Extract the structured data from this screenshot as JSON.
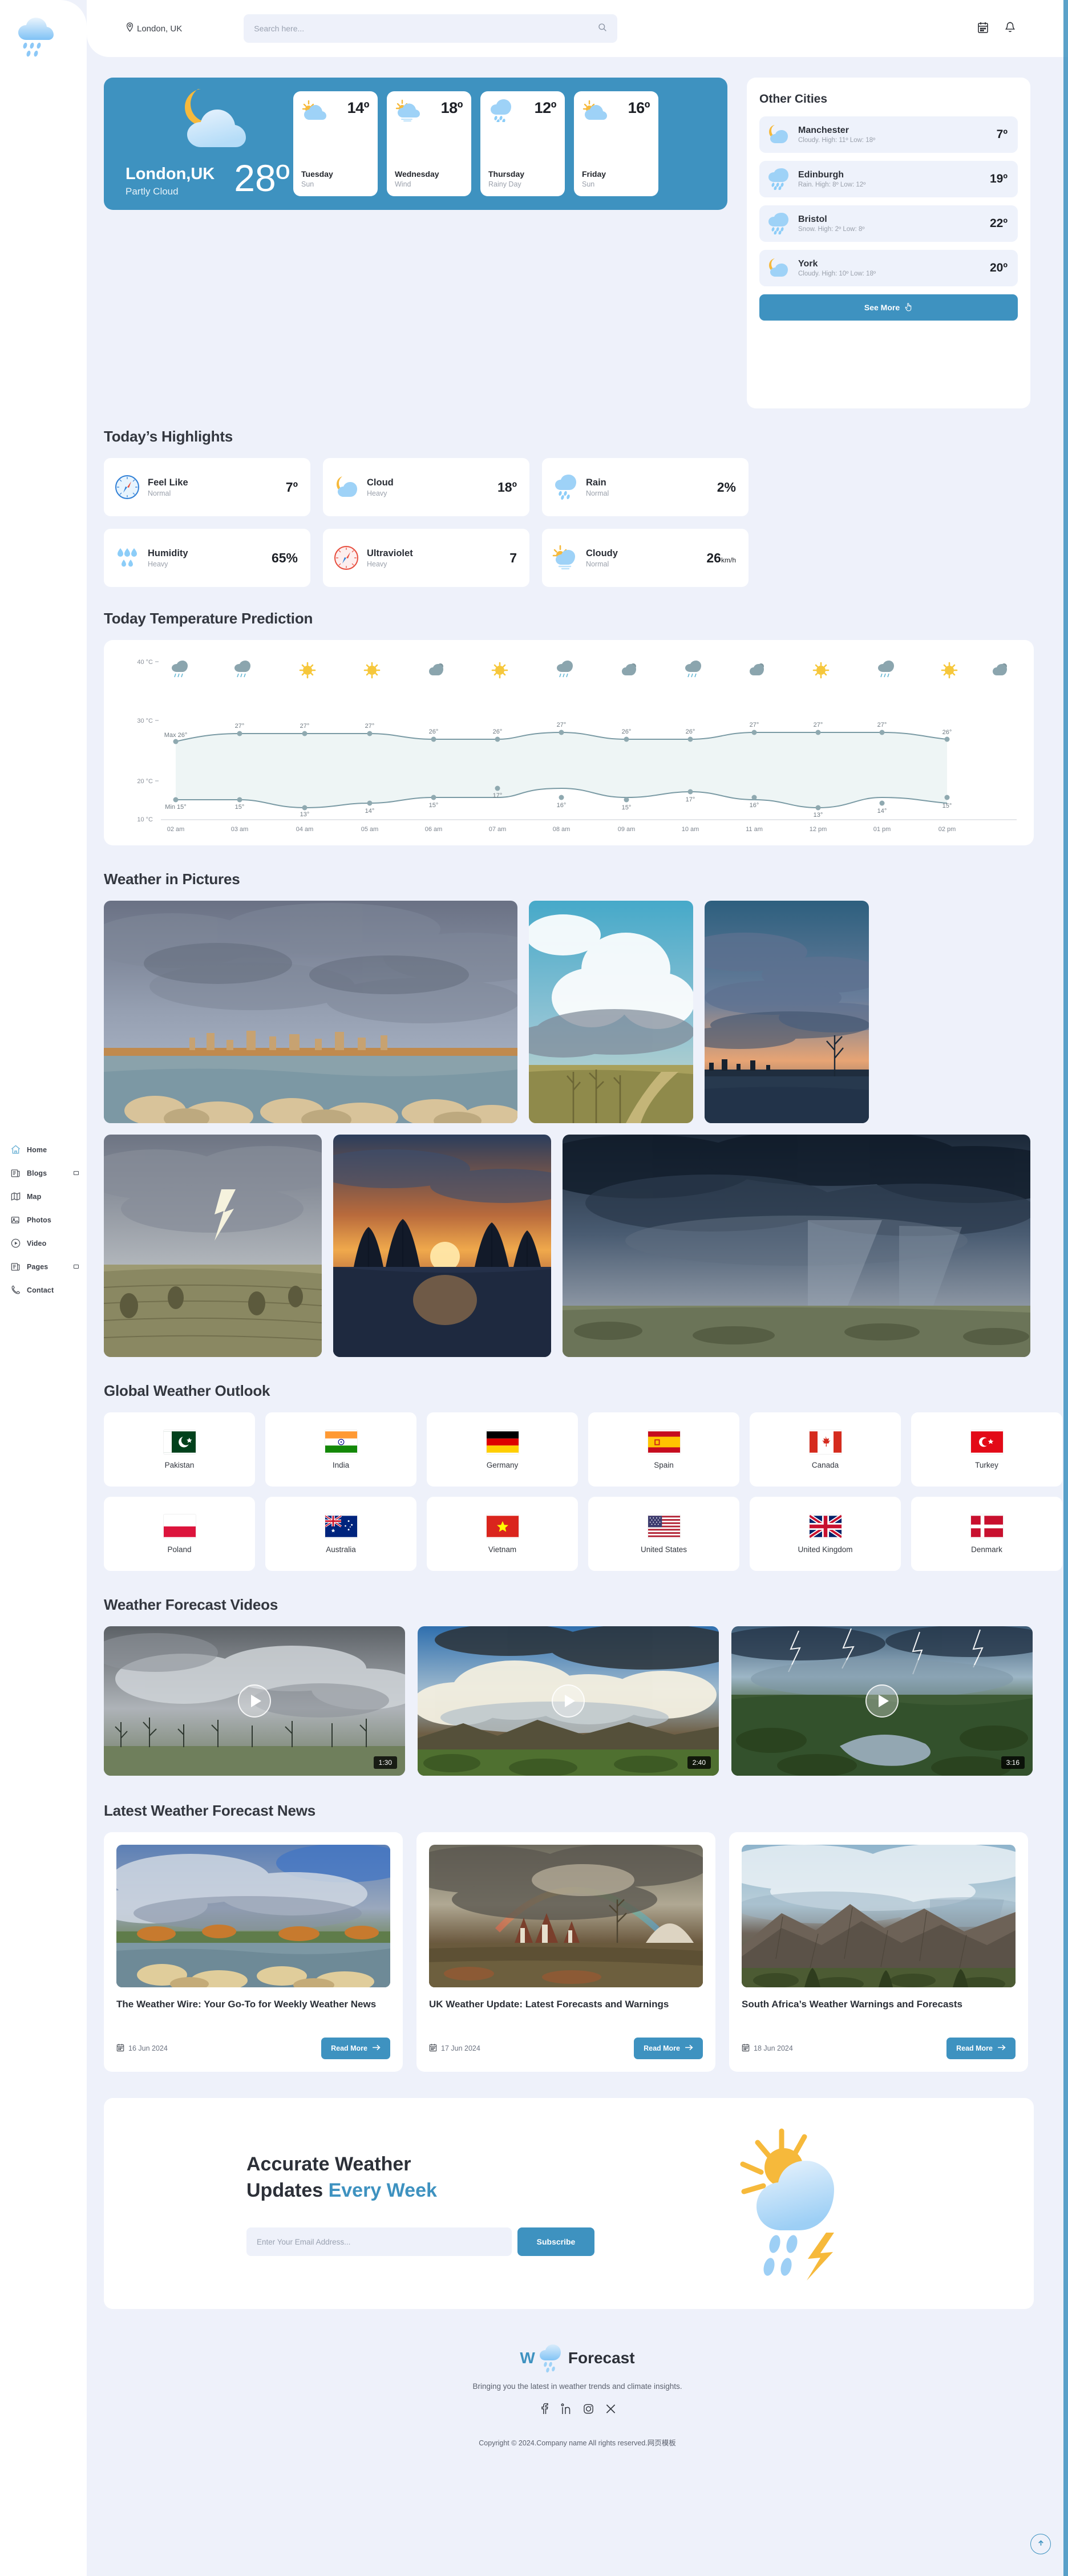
{
  "brand": {
    "logo_w": "W",
    "logo_text": "Forecast"
  },
  "topbar": {
    "location": "London, UK",
    "search_placeholder": "Search here...",
    "search_value": "",
    "icons": {
      "location": "location-pin-icon",
      "search": "search-icon",
      "calendar": "calendar-icon",
      "bell": "bell-icon"
    }
  },
  "sidebar": {
    "items": [
      {
        "label": "Home",
        "icon": "home-icon",
        "caret": false
      },
      {
        "label": "Blogs",
        "icon": "news-icon",
        "caret": true
      },
      {
        "label": "Map",
        "icon": "map-icon",
        "caret": false
      },
      {
        "label": "Photos",
        "icon": "photo-icon",
        "caret": false
      },
      {
        "label": "Video",
        "icon": "play-circle-icon",
        "caret": false
      },
      {
        "label": "Pages",
        "icon": "news-icon",
        "caret": true
      },
      {
        "label": "Contact",
        "icon": "phone-icon",
        "caret": false
      }
    ]
  },
  "hero": {
    "city": "London,UK",
    "condition": "Partly Cloud",
    "temperature": "28º",
    "icon": "moon-cloud-icon",
    "accent": "#3e92c0"
  },
  "forecast": [
    {
      "day": "Tuesday",
      "desc": "Sun",
      "temp": "14º",
      "icon": "sun-cloud-icon"
    },
    {
      "day": "Wednesday",
      "desc": "Wind",
      "temp": "18º",
      "icon": "sun-cloud-wind-icon"
    },
    {
      "day": "Thursday",
      "desc": "Rainy Day",
      "temp": "12º",
      "icon": "rain-cloud-icon"
    },
    {
      "day": "Friday",
      "desc": "Sun",
      "temp": "16º",
      "icon": "sun-cloud-icon"
    }
  ],
  "other_cities": {
    "title": "Other Cities",
    "see_more": "See More",
    "items": [
      {
        "name": "Manchester",
        "sub": "Cloudy. High: 11º Low: 18º",
        "temp": "7º",
        "icon": "moon-cloud-icon"
      },
      {
        "name": "Edinburgh",
        "sub": "Rain. High: 8º Low: 12º",
        "temp": "19º",
        "icon": "rain-cloud-icon"
      },
      {
        "name": "Bristol",
        "sub": "Snow. High: 2º Low: 8º",
        "temp": "22º",
        "icon": "rain-cloud-icon"
      },
      {
        "name": "York",
        "sub": "Cloudy. High: 10º Low: 18º",
        "temp": "20º",
        "icon": "moon-cloud-icon"
      }
    ]
  },
  "highlights": {
    "title": "Today’s Highlights",
    "items": [
      {
        "name": "Feel Like",
        "status": "Normal",
        "value": "7º",
        "unit": "",
        "icon": "compass-blue-icon"
      },
      {
        "name": "Cloud",
        "status": "Heavy",
        "value": "18º",
        "unit": "",
        "icon": "moon-cloud-icon"
      },
      {
        "name": "Rain",
        "status": "Normal",
        "value": "2%",
        "unit": "",
        "icon": "rain-cloud-icon"
      },
      {
        "name": "Humidity",
        "status": "Heavy",
        "value": "65%",
        "unit": "",
        "icon": "droplets-icon"
      },
      {
        "name": "Ultraviolet",
        "status": "Heavy",
        "value": "7",
        "unit": "",
        "icon": "compass-red-icon"
      },
      {
        "name": "Cloudy",
        "status": "Normal",
        "value": "26",
        "unit": "km/h",
        "icon": "sun-cloud-wind-icon"
      }
    ]
  },
  "chart_data": {
    "type": "line",
    "title": "Today Temperature Prediction",
    "xlabel": "",
    "ylabel": "",
    "ylim": [
      10,
      40
    ],
    "yticks": [
      "10 °C",
      "20 °C",
      "30 °C",
      "40 °C"
    ],
    "grid": false,
    "legend": "none",
    "x": [
      "02 am",
      "03 am",
      "04 am",
      "05 am",
      "06 am",
      "07 am",
      "08 am",
      "09 am",
      "10 am",
      "11 am",
      "12 pm",
      "01 pm",
      "02 pm"
    ],
    "series": [
      {
        "name": "Max",
        "values": [
          26,
          27,
          27,
          27,
          26,
          26,
          27,
          26,
          26,
          27,
          27,
          27,
          26
        ],
        "labels": [
          "Max 26°",
          "27°",
          "27°",
          "27°",
          "26°",
          "26°",
          "27°",
          "26°",
          "26°",
          "27°",
          "27°",
          "27°",
          "26°"
        ]
      },
      {
        "name": "Min",
        "values": [
          15,
          15,
          13,
          14,
          15,
          17,
          16,
          15,
          17,
          16,
          13,
          14,
          15
        ],
        "labels": [
          "Min 15°",
          "15°",
          "13°",
          "14°",
          "15°",
          "17°",
          "16°",
          "15°",
          "17°",
          "16°",
          "13°",
          "14°",
          "15°"
        ]
      }
    ],
    "condition_icons": [
      "rain",
      "rain",
      "sun",
      "sun",
      "cloud",
      "sun",
      "rain",
      "cloud",
      "rain",
      "cloud",
      "sun",
      "rain",
      "sun",
      "sun",
      "cloud"
    ],
    "line_color": "#7a9aa4",
    "fill_color": "#eef5f5"
  },
  "pictures": {
    "title": "Weather in Pictures"
  },
  "global": {
    "title": "Global Weather Outlook",
    "countries": [
      {
        "name": "Pakistan",
        "flag": "pk"
      },
      {
        "name": "India",
        "flag": "in"
      },
      {
        "name": "Germany",
        "flag": "de"
      },
      {
        "name": "Spain",
        "flag": "es"
      },
      {
        "name": "Canada",
        "flag": "ca"
      },
      {
        "name": "Turkey",
        "flag": "tr"
      },
      {
        "name": "Poland",
        "flag": "pl"
      },
      {
        "name": "Australia",
        "flag": "au"
      },
      {
        "name": "Vietnam",
        "flag": "vn"
      },
      {
        "name": "United States",
        "flag": "us"
      },
      {
        "name": "United Kingdom",
        "flag": "gb"
      },
      {
        "name": "Denmark",
        "flag": "dk"
      }
    ]
  },
  "videos": {
    "title": "Weather Forecast Videos",
    "items": [
      {
        "duration": "1:30",
        "scene": "overcast-field"
      },
      {
        "duration": "2:40",
        "scene": "cumulus-mountains"
      },
      {
        "duration": "3:16",
        "scene": "lightning-lake"
      }
    ]
  },
  "news": {
    "title": "Latest Weather Forecast News",
    "read_more": "Read More",
    "items": [
      {
        "title": "The Weather Wire: Your Go-To for Weekly Weather News",
        "date": "16 Jun 2024",
        "scene": "coast-storm"
      },
      {
        "title": "UK Weather Update: Latest Forecasts and Warnings",
        "date": "17 Jun 2024",
        "scene": "rainbow-town"
      },
      {
        "title": "South Africa’s Weather Warnings and Forecasts",
        "date": "18 Jun 2024",
        "scene": "mountain-clouds"
      }
    ]
  },
  "newsletter": {
    "line1": "Accurate Weather",
    "line2_plain": "Updates ",
    "line2_accent": "Every Week",
    "email_placeholder": "Enter Your Email Address...",
    "email_value": "",
    "subscribe": "Subscribe"
  },
  "footer": {
    "tagline": "Bringing you the latest in weather trends and climate insights.",
    "copyright": "Copyright © 2024.Company name All rights reserved.网页模板",
    "social": [
      "facebook-icon",
      "linkedin-icon",
      "instagram-icon",
      "x-icon"
    ]
  }
}
